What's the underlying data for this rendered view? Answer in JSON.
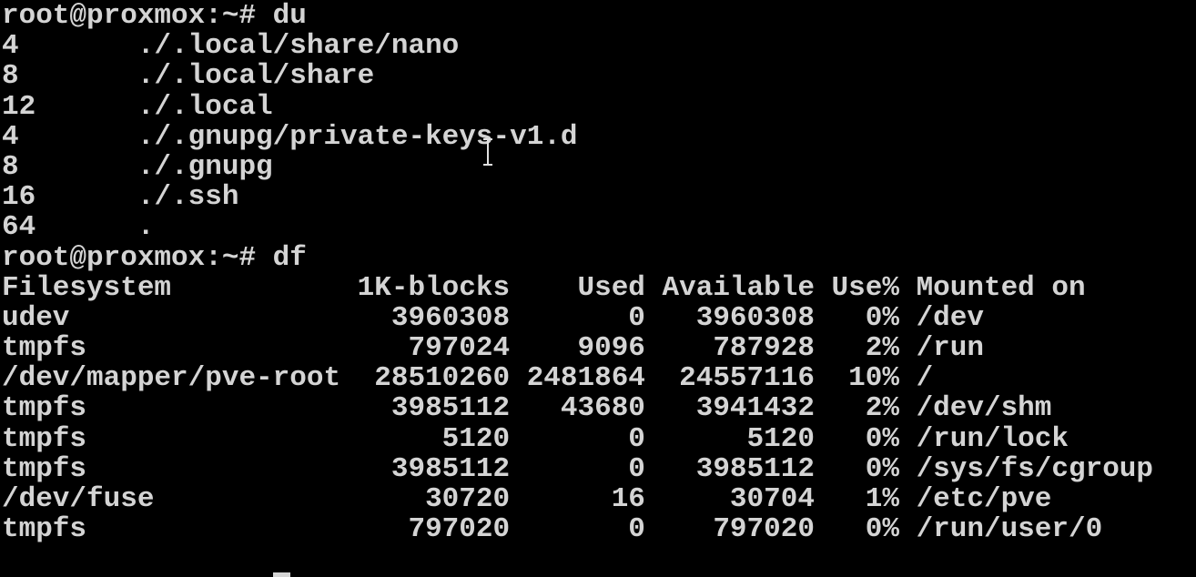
{
  "terminal": {
    "lines": [
      "root@proxmox:~# du",
      "4       ./.local/share/nano",
      "8       ./.local/share",
      "12      ./.local",
      "4       ./.gnupg/private-keys-v1.d",
      "8       ./.gnupg",
      "16      ./.ssh",
      "64      .",
      "root@proxmox:~# df",
      "Filesystem           1K-blocks    Used Available Use% Mounted on",
      "udev                   3960308       0   3960308   0% /dev",
      "tmpfs                   797024    9096    787928   2% /run",
      "/dev/mapper/pve-root  28510260 2481864  24557116  10% /",
      "tmpfs                  3985112   43680   3941432   2% /dev/shm",
      "tmpfs                     5120       0      5120   0% /run/lock",
      "tmpfs                  3985112       0   3985112   0% /sys/fs/cgroup",
      "/dev/fuse                30720      16     30704   1% /etc/pve",
      "tmpfs                   797020       0    797020   0% /run/user/0"
    ]
  },
  "colors": {
    "background": "#000000",
    "foreground": "#d4d4d4"
  }
}
